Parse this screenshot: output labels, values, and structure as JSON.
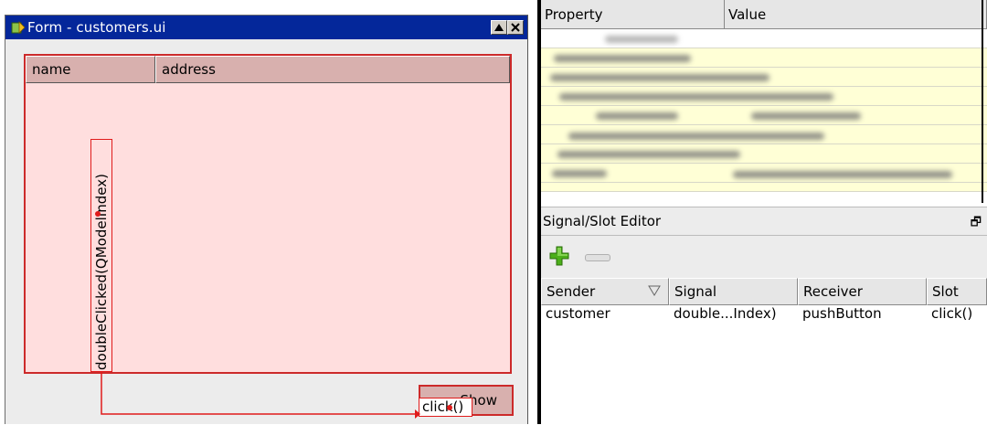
{
  "form": {
    "title": "Form - customers.ui",
    "table_columns": [
      "name",
      "address"
    ],
    "signal_label": "doubleClicked(QModelIndex)",
    "button_label": "Show",
    "slot_label": "click()"
  },
  "property_editor": {
    "columns": [
      "Property",
      "Value"
    ]
  },
  "signal_slot_editor": {
    "title": "Signal/Slot Editor",
    "columns": [
      "Sender",
      "Signal",
      "Receiver",
      "Slot"
    ],
    "rows": [
      {
        "sender": "customer",
        "signal": "double...Index)",
        "receiver": "pushButton",
        "slot": "click()"
      }
    ]
  },
  "colors": {
    "titlebar": "#04279a",
    "selection_border": "#cc2a2a",
    "connection_line": "#e01b1b",
    "table_bg": "#ffdede",
    "row_highlight": "#ffffd6"
  },
  "icons": {
    "app": "qt-designer-icon",
    "minimize": "minimize-icon",
    "close": "close-icon",
    "add": "plus-icon",
    "remove": "minus-icon",
    "float": "float-dock-icon",
    "sort": "sort-triangle-icon"
  }
}
